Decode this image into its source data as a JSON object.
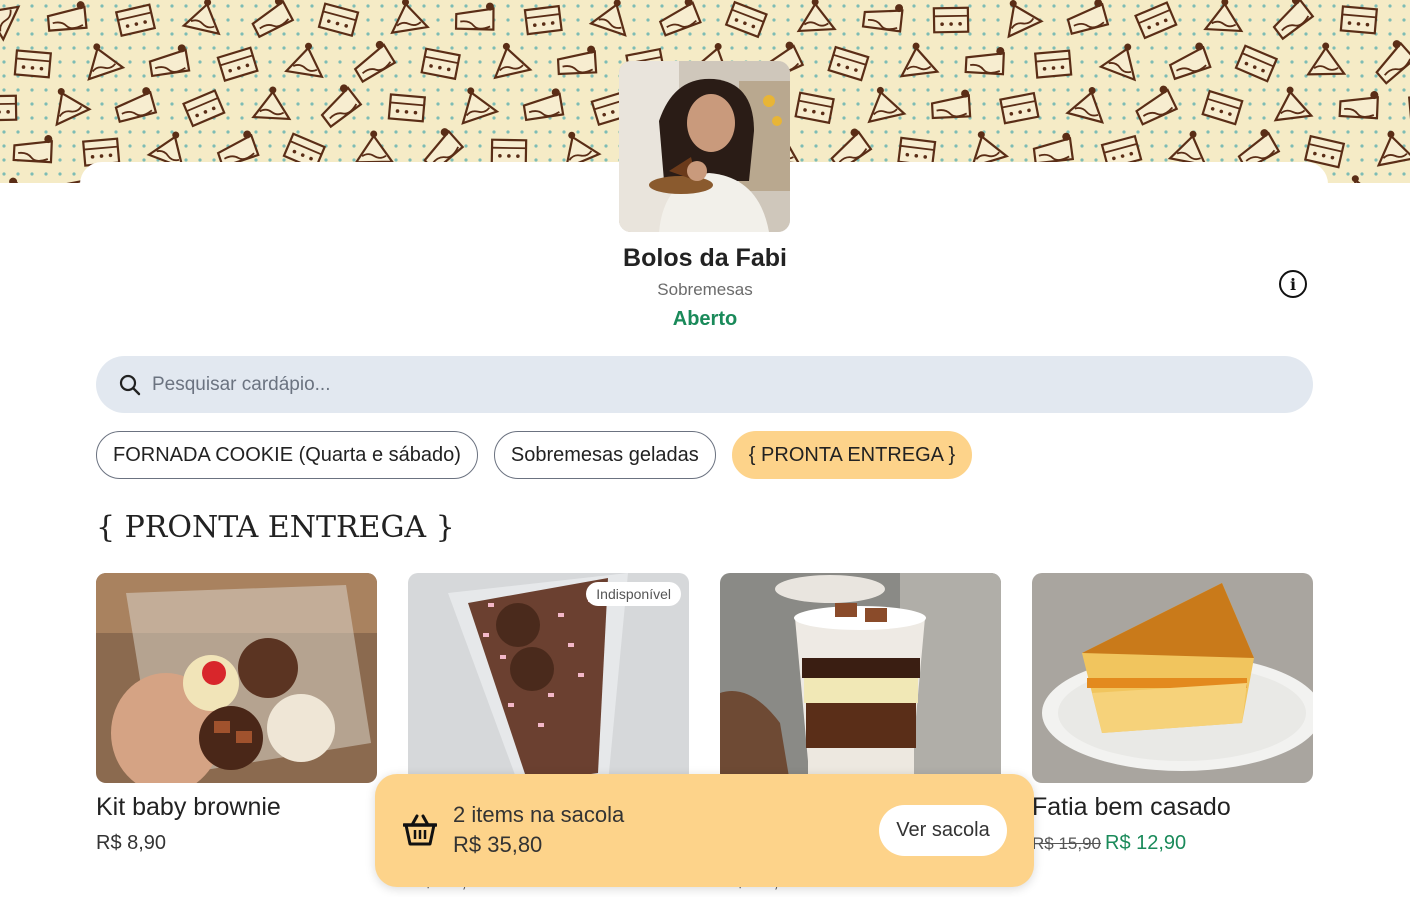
{
  "store": {
    "name": "Bolos da Fabi",
    "category": "Sobremesas",
    "status": "Aberto",
    "status_color": "#1a8a5a",
    "info_icon": "info-icon"
  },
  "search": {
    "placeholder": "Pesquisar cardápio...",
    "icon": "search-icon"
  },
  "tabs": [
    {
      "label": "FORNADA COOKIE (Quarta e sábado)",
      "active": false
    },
    {
      "label": "Sobremesas geladas",
      "active": false
    },
    {
      "label": "{ PRONTA ENTREGA }",
      "active": true
    }
  ],
  "section": {
    "title": "{ PRONTA ENTREGA }"
  },
  "products": [
    {
      "name": "Kit baby brownie",
      "price": "R$ 8,90",
      "badge": ""
    },
    {
      "name": "",
      "price": "R$ 15,90",
      "badge": "Indisponível"
    },
    {
      "name": "",
      "price": "R$ 15,90",
      "badge": ""
    },
    {
      "name": "Fatia bem casado",
      "old_price": "R$ 15,90",
      "price": "R$ 12,90",
      "badge": ""
    }
  ],
  "cart": {
    "count_text": "2 items na sacola",
    "total": "R$ 35,80",
    "button_label": "Ver sacola",
    "icon": "basket-icon"
  },
  "colors": {
    "accent": "#fdd38a",
    "banner_bg": "#f5ebc6",
    "doodle": "#5a2d16",
    "search_bg": "#e2e8f0",
    "price_green": "#1a8a5a"
  }
}
